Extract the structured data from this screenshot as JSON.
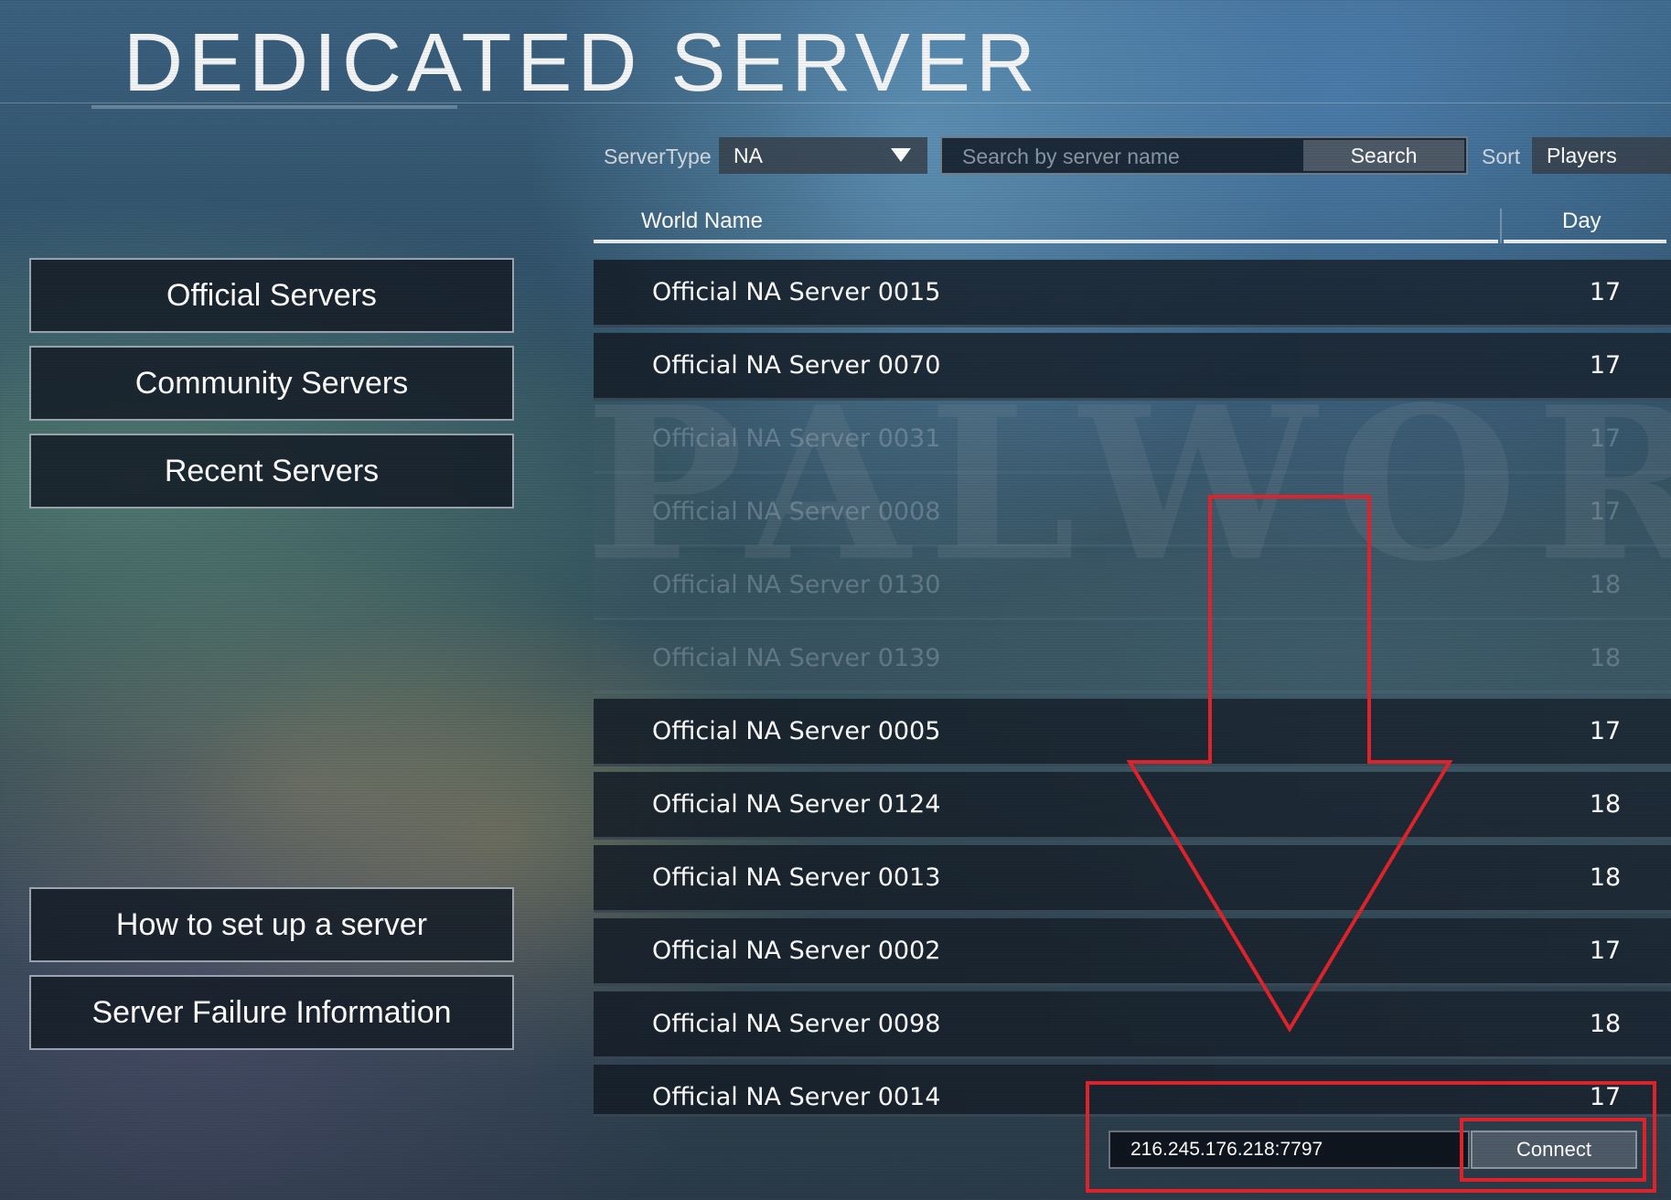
{
  "header": {
    "title": "DEDICATED SERVER"
  },
  "watermark": "PALWORLD",
  "sidebar": {
    "items": [
      {
        "label": "Official Servers"
      },
      {
        "label": "Community Servers"
      },
      {
        "label": "Recent Servers"
      }
    ],
    "info_items": [
      {
        "label": "How to set up a server"
      },
      {
        "label": "Server Failure Information"
      }
    ]
  },
  "filters": {
    "server_type_label": "ServerType",
    "server_type_value": "NA",
    "search_placeholder": "Search by server name",
    "search_button": "Search",
    "sort_label": "Sort",
    "sort_value": "Players"
  },
  "table": {
    "columns": [
      "World Name",
      "Day"
    ],
    "rows": [
      {
        "name": "Official NA Server 0015",
        "day": "17"
      },
      {
        "name": "Official NA Server 0070",
        "day": "17"
      },
      {
        "name": "Official NA Server 0031",
        "day": "17"
      },
      {
        "name": "Official NA Server 0008",
        "day": "17"
      },
      {
        "name": "Official NA Server 0130",
        "day": "18"
      },
      {
        "name": "Official NA Server 0139",
        "day": "18"
      },
      {
        "name": "Official NA Server 0005",
        "day": "17"
      },
      {
        "name": "Official NA Server 0124",
        "day": "18"
      },
      {
        "name": "Official NA Server 0013",
        "day": "18"
      },
      {
        "name": "Official NA Server 0002",
        "day": "17"
      },
      {
        "name": "Official NA Server 0098",
        "day": "18"
      },
      {
        "name": "Official NA Server 0014",
        "day": "17"
      }
    ]
  },
  "connect": {
    "ip_value": "216.245.176.218:7797",
    "button_label": "Connect"
  },
  "colors": {
    "annotation_red": "#e2232b",
    "header_line": "#e8edf2"
  }
}
